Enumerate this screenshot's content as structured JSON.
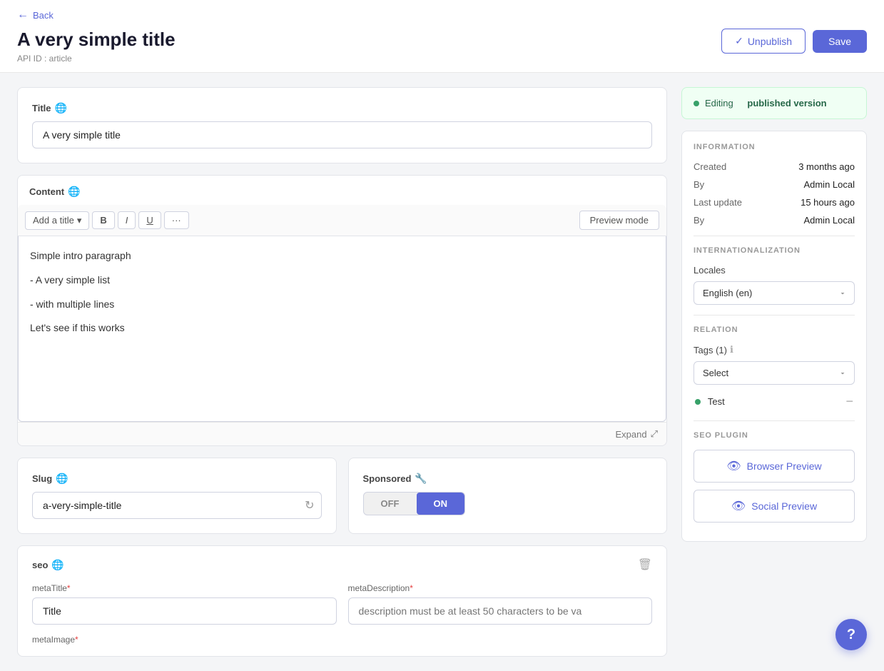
{
  "header": {
    "back_label": "Back",
    "page_title": "A very simple title",
    "api_id": "API ID : article",
    "unpublish_label": "Unpublish",
    "save_label": "Save"
  },
  "status": {
    "editing_label": "Editing",
    "published_label": "published version"
  },
  "information": {
    "section_title": "INFORMATION",
    "created_label": "Created",
    "created_value": "3 months ago",
    "by_label": "By",
    "by_value": "Admin Local",
    "last_update_label": "Last update",
    "last_update_value": "15 hours ago",
    "by2_label": "By",
    "by2_value": "Admin Local"
  },
  "internationalization": {
    "section_title": "INTERNATIONALIZATION",
    "locales_label": "Locales",
    "locale_value": "English (en)"
  },
  "relation": {
    "section_title": "RELATION",
    "tags_label": "Tags (1)",
    "select_placeholder": "Select",
    "tag_name": "Test"
  },
  "seo_plugin": {
    "section_title": "SEO PLUGIN",
    "browser_preview_label": "Browser Preview",
    "social_preview_label": "Social Preview"
  },
  "title_field": {
    "label": "Title",
    "value": "A very simple title"
  },
  "content_field": {
    "label": "Content",
    "add_title_label": "Add a title",
    "bold_label": "B",
    "italic_label": "I",
    "underline_label": "U",
    "dots_label": "···",
    "preview_mode_label": "Preview mode",
    "line1": "Simple intro paragraph",
    "line2": "- A very simple list",
    "line3": "- with multiple lines",
    "line4": "Let's see if this works",
    "expand_label": "Expand"
  },
  "slug_field": {
    "label": "Slug",
    "value": "a-very-simple-title"
  },
  "sponsored_field": {
    "label": "Sponsored",
    "off_label": "OFF",
    "on_label": "ON"
  },
  "seo_field": {
    "label": "seo",
    "meta_title_label": "metaTitle",
    "meta_title_required": "*",
    "meta_title_value": "Title",
    "meta_description_label": "metaDescription",
    "meta_description_required": "*",
    "meta_description_placeholder": "description must be at least 50 characters to be va",
    "meta_image_label": "metaImage",
    "meta_image_required": "*"
  }
}
